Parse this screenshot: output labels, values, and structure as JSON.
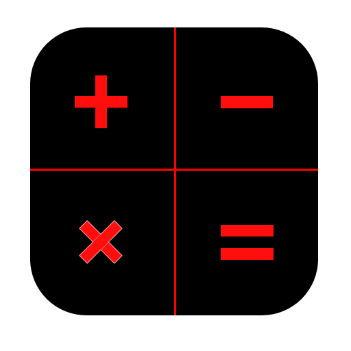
{
  "icon": {
    "name": "calculator-app-icon",
    "colors": {
      "background": "#ffffff",
      "tile": "#000000",
      "accent": "#ff0000",
      "symbol": "#ff0e0e",
      "symbol_outline": "#ffaaaa"
    },
    "quadrants": [
      {
        "icon": "plus-icon"
      },
      {
        "icon": "minus-icon"
      },
      {
        "icon": "multiply-icon"
      },
      {
        "icon": "equals-icon"
      }
    ]
  }
}
